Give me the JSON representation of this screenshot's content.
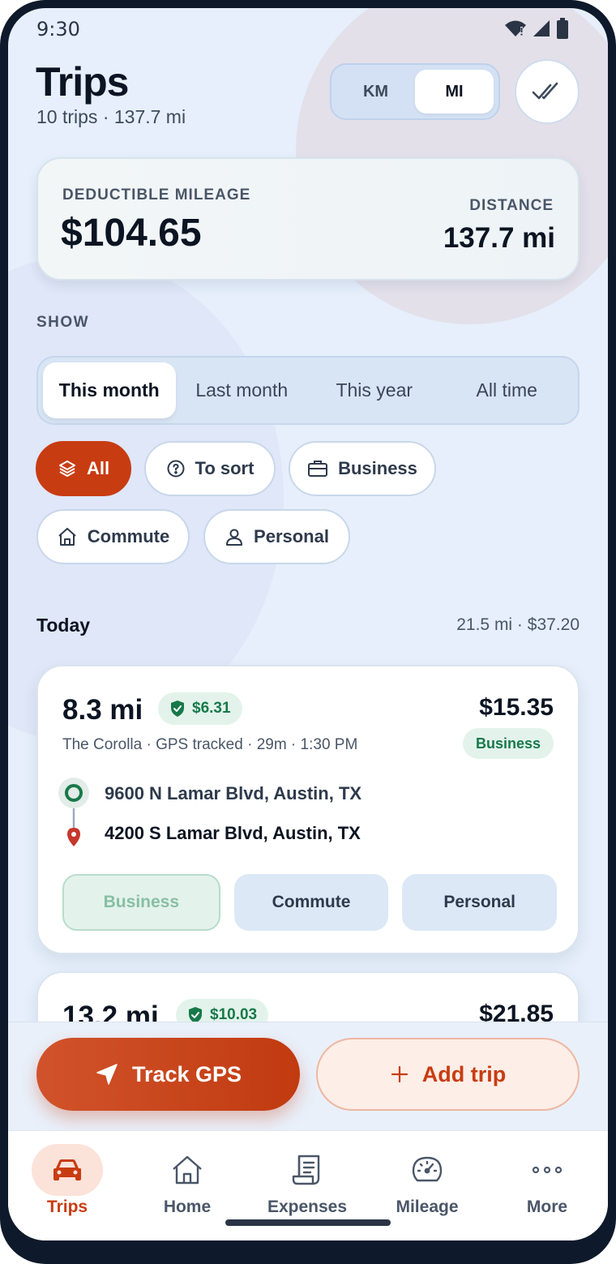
{
  "status_bar": {
    "time": "9:30"
  },
  "header": {
    "title": "Trips",
    "subtitle": "10 trips · 137.7 mi"
  },
  "unit_toggle": {
    "options": [
      "KM",
      "MI"
    ],
    "selected": "MI"
  },
  "summary": {
    "deductible_label": "DEDUCTIBLE MILEAGE",
    "deductible_amount": "$104.65",
    "distance_label": "DISTANCE",
    "distance_value": "137.7 mi"
  },
  "filters": {
    "show_label": "SHOW",
    "periods": [
      "This month",
      "Last month",
      "This year",
      "All time"
    ],
    "selected_period": "This month",
    "categories": [
      "All",
      "To sort",
      "Business",
      "Commute",
      "Personal"
    ],
    "selected_category": "All"
  },
  "groups": [
    {
      "label": "Today",
      "total": "21.5 mi · $37.20",
      "trips": [
        {
          "miles": "8.3 mi",
          "deduction": "$6.31",
          "price": "$15.35",
          "category": "Business",
          "meta": "The Corolla · GPS tracked · 29m · 1:30 PM",
          "from": "9600 N Lamar Blvd, Austin, TX",
          "to": "4200 S Lamar Blvd, Austin, TX",
          "classify_options": [
            "Business",
            "Commute",
            "Personal"
          ]
        },
        {
          "miles": "13.2 mi",
          "deduction": "$10.03",
          "price": "$21.85"
        }
      ]
    }
  ],
  "actions": {
    "track": "Track GPS",
    "add": "Add trip"
  },
  "nav": {
    "items": [
      "Trips",
      "Home",
      "Expenses",
      "Mileage",
      "More"
    ],
    "active": "Trips"
  },
  "colors": {
    "accent": "#c83c12",
    "accent_light": "#fbe3d9",
    "success": "#17794a",
    "success_bg": "#e3f3ec",
    "background": "#e6effb",
    "text": "#0b1422"
  }
}
